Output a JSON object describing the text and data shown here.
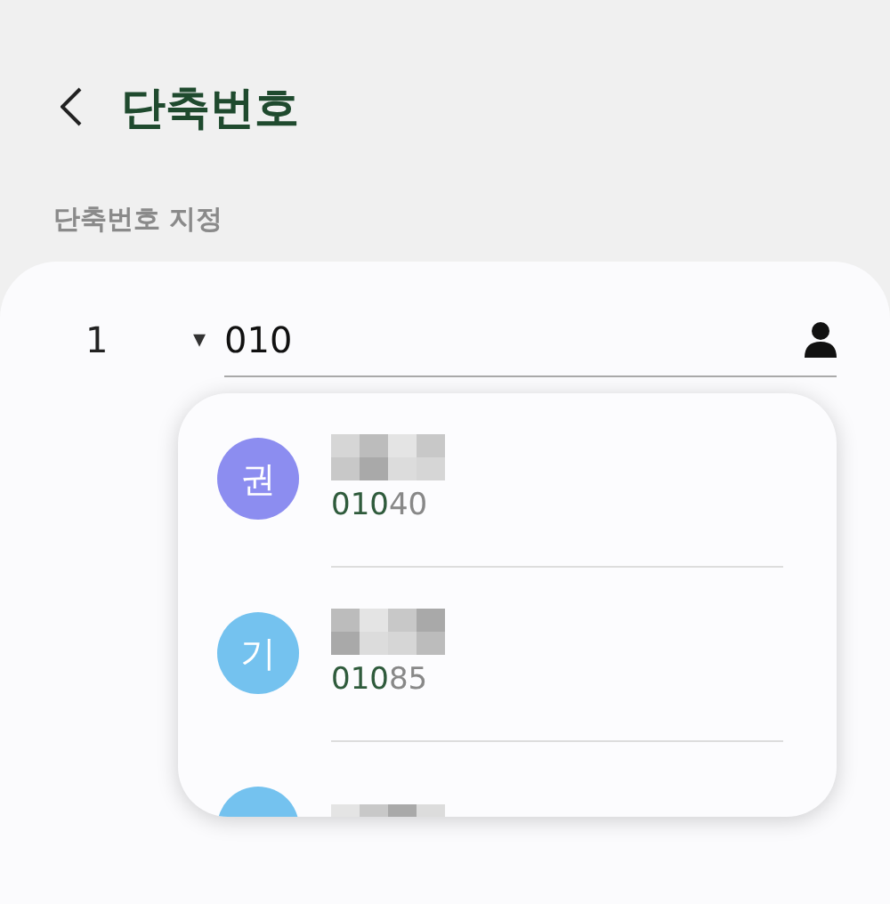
{
  "header": {
    "title": "단축번호"
  },
  "section_label": "단축번호 지정",
  "entry": {
    "slot": "1",
    "caret": "▾",
    "value": "010"
  },
  "suggestions": [
    {
      "initial": "권",
      "color": "#8c8df0",
      "number_match": "010",
      "number_rest": "40"
    },
    {
      "initial": "기",
      "color": "#74c2ef",
      "number_match": "010",
      "number_rest": "85"
    },
    {
      "color": "#74c2ef"
    }
  ]
}
